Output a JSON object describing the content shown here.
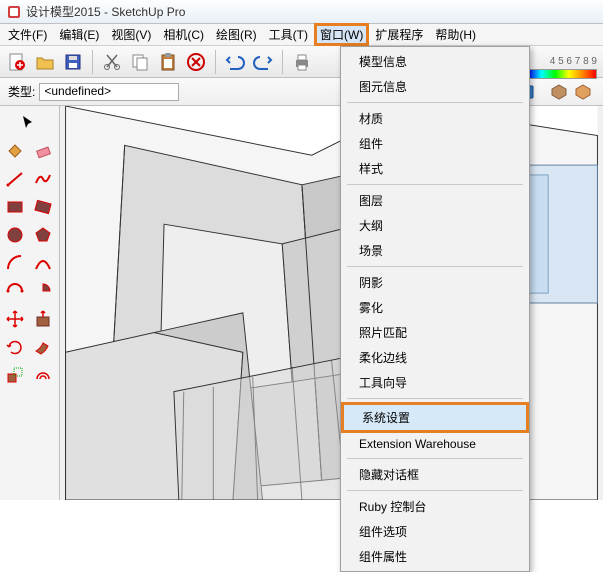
{
  "window": {
    "title": "设计模型2015 - SketchUp Pro"
  },
  "menubar": {
    "items": [
      {
        "label": "文件(F)"
      },
      {
        "label": "编辑(E)"
      },
      {
        "label": "视图(V)"
      },
      {
        "label": "相机(C)"
      },
      {
        "label": "绘图(R)"
      },
      {
        "label": "工具(T)"
      },
      {
        "label": "窗口(W)",
        "highlighted": true
      },
      {
        "label": "扩展程序"
      },
      {
        "label": "帮助(H)"
      }
    ]
  },
  "type_bar": {
    "label": "类型:",
    "value": "<undefined>"
  },
  "dropdown": {
    "groups": [
      [
        "模型信息",
        "图元信息"
      ],
      [
        "材质",
        "组件",
        "样式"
      ],
      [
        "图层",
        "大纲",
        "场景"
      ],
      [
        "阴影",
        "雾化",
        "照片匹配",
        "柔化边线",
        "工具向导"
      ],
      [
        "系统设置",
        "Extension Warehouse"
      ],
      [
        "隐藏对话框"
      ],
      [
        "Ruby 控制台",
        "组件选项",
        "组件属性"
      ]
    ],
    "highlighted": "系统设置"
  },
  "toolbar_icons": {
    "new": "new-file-icon",
    "open": "open-file-icon",
    "save": "save-icon",
    "cut": "cut-icon",
    "copy": "copy-icon",
    "paste": "paste-icon",
    "delete": "delete-icon",
    "undo": "undo-icon",
    "redo": "redo-icon",
    "print": "print-icon"
  },
  "color_scale": {
    "labels": "4 5 6 7 8 9"
  }
}
